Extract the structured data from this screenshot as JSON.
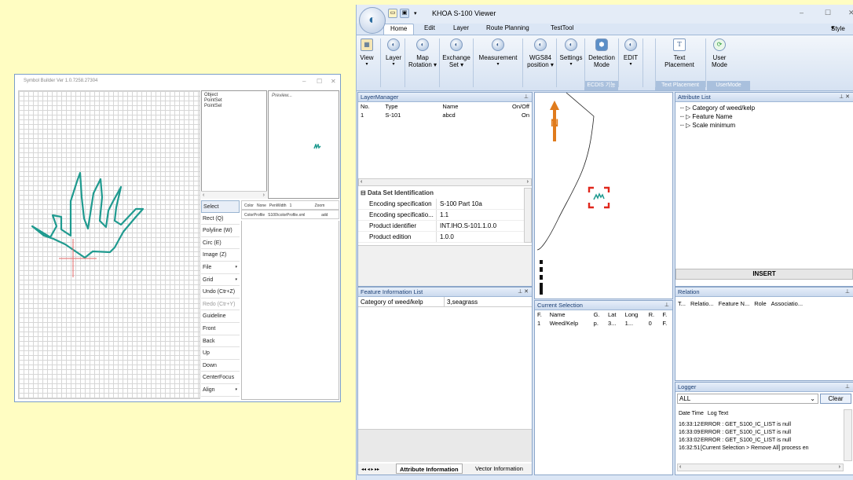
{
  "symbol_builder": {
    "title": "Symbol Builder Ver 1.0.7258.27304",
    "controls": [
      "–",
      "☐",
      "✕"
    ],
    "object_list": [
      "Object",
      "PointSet",
      "PointSel"
    ],
    "preview_label": "Preview...",
    "tools": [
      {
        "label": "Select",
        "selected": true
      },
      {
        "label": "Rect (Q)"
      },
      {
        "label": "Polyline (W)"
      },
      {
        "label": "Circ (E)"
      },
      {
        "label": "Image (Z)"
      },
      {
        "label": "File",
        "dropdown": true
      },
      {
        "label": "Grid",
        "dropdown": true
      },
      {
        "label": "Undo (Ctr+Z)"
      },
      {
        "label": "Redo (Ctr+Y)",
        "disabled": true
      },
      {
        "label": "Guideline"
      },
      {
        "label": "Front"
      },
      {
        "label": "Back"
      },
      {
        "label": "Up"
      },
      {
        "label": "Down"
      },
      {
        "label": "CenterFocus"
      },
      {
        "label": "Align",
        "dropdown": true
      }
    ],
    "props": {
      "color_label": "Color",
      "color_value": "None",
      "penwidth_label": "PenWidth",
      "penwidth_value": "1",
      "zoom_label": "Zoom",
      "colorprofile_label": "ColorProfile",
      "colorprofile_value": "S100\\colorProfile.xml",
      "add_label": "add"
    },
    "stroke_color": "#1f9a8f"
  },
  "khoa": {
    "title": "KHOA S-100 Viewer",
    "controls": [
      "–",
      "☐",
      "✕"
    ],
    "tabs": [
      "Home",
      "Edit",
      "Layer",
      "Route Planning",
      "TestTool"
    ],
    "style_label": "Style",
    "ribbon_buttons": [
      {
        "label": "View",
        "dd": true
      },
      {
        "label": "Layer",
        "dd": true
      },
      {
        "label": "Map\nRotation",
        "dd": true
      },
      {
        "label": "Exchange\nSet",
        "dd": true
      },
      {
        "label": "Measurement",
        "dd": true
      },
      {
        "label": "WGS84\nposition",
        "dd": true
      },
      {
        "label": "Settings",
        "dd": true
      },
      {
        "label": "Detection\nMode",
        "dd": false
      },
      {
        "label": "EDIT",
        "dd": true
      },
      {
        "label": "Text\nPlacement",
        "dd": false
      },
      {
        "label": "User\nMode",
        "dd": false
      }
    ],
    "ribbon_groups": [
      "ECDIS 기능",
      "Text Placement",
      "UserMode"
    ],
    "layer_manager": {
      "title": "LayerManager",
      "headers": [
        "No.",
        "Type",
        "Name",
        "On/Off"
      ],
      "rows": [
        [
          "1",
          "S-101",
          "abcd",
          "On"
        ]
      ]
    },
    "dataset": {
      "section": "Data Set Identification",
      "rows": [
        [
          "Encoding specification",
          "S-100 Part 10a"
        ],
        [
          "Encoding specificatio...",
          "1.1"
        ],
        [
          "Product identifier",
          "INT.IHO.S-101.1.0.0"
        ],
        [
          "Product edition",
          "1.0.0"
        ]
      ]
    },
    "feature_info": {
      "title": "Feature Information List",
      "rows": [
        [
          "Category of weed/kelp",
          "3,seagrass"
        ]
      ]
    },
    "bottom_tabs": [
      "Attribute Information",
      "Vector Information"
    ],
    "current_selection": {
      "title": "Current Selection",
      "headers": [
        "F.",
        "Name",
        "G.",
        "Lat",
        "Long",
        "R.",
        "F."
      ],
      "rows": [
        [
          "1",
          "Weed/Kelp",
          "p.",
          "3...",
          "1...",
          "0",
          "F."
        ]
      ]
    },
    "attribute_list": {
      "title": "Attribute List",
      "items": [
        "Category of weed/kelp",
        "Feature Name",
        "Scale minimum"
      ],
      "insert_label": "INSERT"
    },
    "relation": {
      "title": "Relation",
      "headers": [
        "T...",
        "Relatio...",
        "Feature N...",
        "Role",
        "Associatio..."
      ]
    },
    "logger": {
      "title": "Logger",
      "filter": "ALL",
      "clear_label": "Clear",
      "headers": [
        "Date Time",
        "Log Text"
      ],
      "lines": [
        [
          "16:33:12",
          "ERROR : GET_S100_IC_LIST is null"
        ],
        [
          "16:33:09",
          "ERROR : GET_S100_IC_LIST is null"
        ],
        [
          "16:33:02",
          "ERROR : GET_S100_IC_LIST is null"
        ],
        [
          "16:32:51",
          "[Current Selection > Remove All] process en"
        ]
      ]
    },
    "north_label": "N",
    "accent": "#e07b1c",
    "highlight": "#e0271c"
  }
}
